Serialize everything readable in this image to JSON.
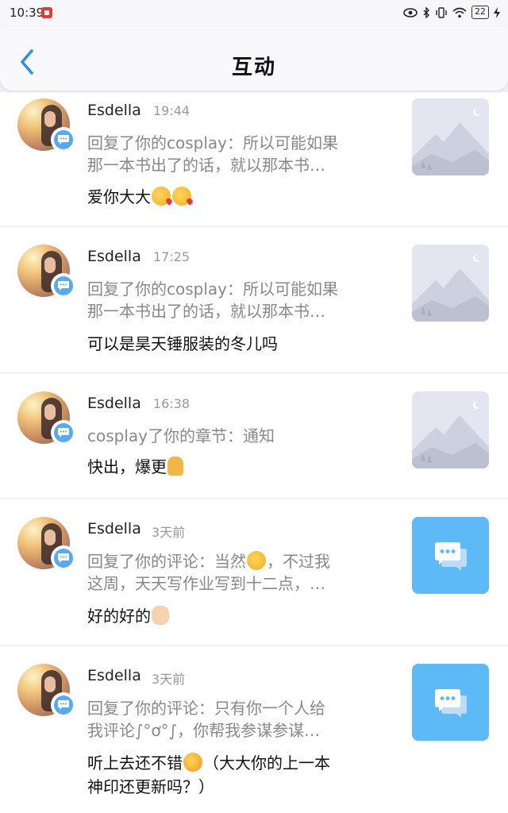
{
  "status_bar": {
    "time": "10:39",
    "battery": "22"
  },
  "header": {
    "title": "互动"
  },
  "items": [
    {
      "name": "Esdella",
      "time": "19:44",
      "quote_line1": "回复了你的cosplay：所以可能如果",
      "quote_line2": "那一本书出了的话，就以那本书…",
      "reply": "爱你大大",
      "reply_emojis": [
        "kiss-emoji",
        "kiss-emoji"
      ],
      "thumb": "image-placeholder"
    },
    {
      "name": "Esdella",
      "time": "17:25",
      "quote_line1": "回复了你的cosplay：所以可能如果",
      "quote_line2": "那一本书出了的话，就以那本书…",
      "reply": "可以是昊天锤服装的冬儿吗",
      "thumb": "image-placeholder"
    },
    {
      "name": "Esdella",
      "time": "16:38",
      "quote_line1": "cosplay了你的章节：通知",
      "reply": "快出，爆更",
      "reply_emojis": [
        "pray-emoji"
      ],
      "thumb": "image-placeholder"
    },
    {
      "name": "Esdella",
      "time": "3天前",
      "quote_line1": "回复了你的评论：当然",
      "quote_line1_emoji": "smile-emoji",
      "quote_line1_tail": "，不过我",
      "quote_line2": "这周，天天写作业写到十二点，…",
      "reply": "好的好的",
      "reply_emojis": [
        "ok-hand-emoji"
      ],
      "thumb": "chat-icon"
    },
    {
      "name": "Esdella",
      "time": "3天前",
      "quote_line1": "回复了你的评论：只有你一个人给",
      "quote_line2": "我评论∫°ơ°∫，你帮我参谋参谋…",
      "reply_line1_a": "听上去还不错",
      "reply_line1_emoji": "thinking-emoji",
      "reply_line1_b": "（大大你的上一本",
      "reply_line2": "神印还更新吗？）",
      "thumb": "chat-icon"
    }
  ]
}
